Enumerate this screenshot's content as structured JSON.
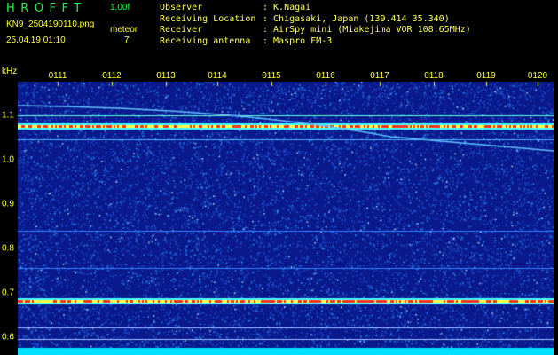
{
  "header": {
    "logo": "HROFFT",
    "version": "1.00f",
    "filename": "KN9_2504190110.png",
    "datetime": "25.04.19 01:10",
    "meteor_label": "meteor",
    "meteor_count": "7",
    "info": [
      {
        "key": "Observer",
        "value": ": K.Nagai"
      },
      {
        "key": "Receiving Location",
        "value": ": Chigasaki, Japan (139.414 35.340)"
      },
      {
        "key": "Receiver",
        "value": ": AirSpy mini (Miakejima VOR 108.65MHz)"
      },
      {
        "key": "Receiving antenna",
        "value": ": Maspro FM-3"
      }
    ]
  },
  "spectrogram": {
    "unit": "kHz",
    "time_ticks": [
      "0111",
      "0112",
      "0113",
      "0114",
      "0115",
      "0116",
      "0117",
      "0118",
      "0119",
      "0120"
    ],
    "freq_ticks": [
      "1.1",
      "1.0",
      "0.9",
      "0.8",
      "0.7",
      "0.6"
    ],
    "freq_range_khz": [
      0.585,
      1.135
    ],
    "colors": {
      "background": "#0a1a8c",
      "noise": "#2aa0ff",
      "carrier": "#ff3020",
      "strong": "#ffff40",
      "line": "#40ffff",
      "bottom_band": "#00e0ff"
    }
  }
}
